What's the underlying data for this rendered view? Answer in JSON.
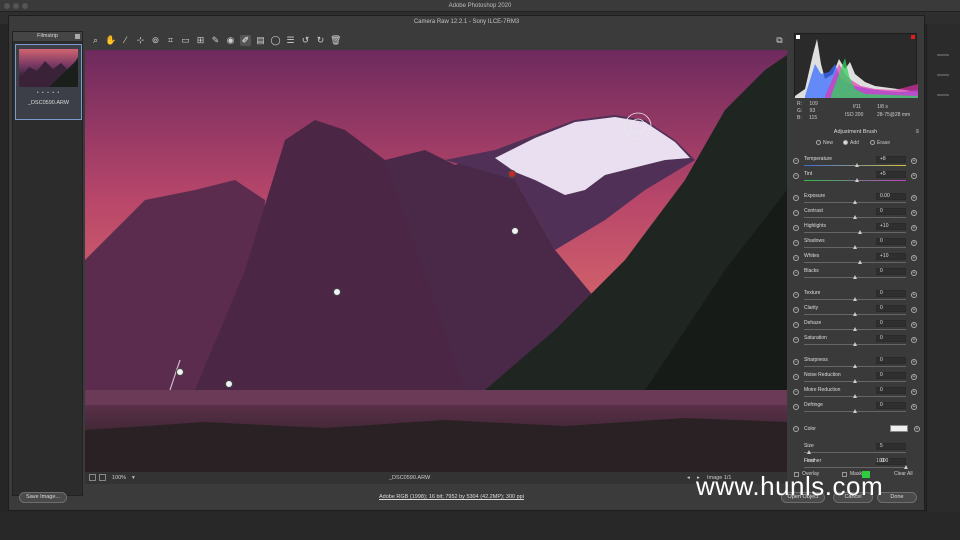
{
  "app": {
    "title": "Adobe Photoshop 2020"
  },
  "dialog": {
    "title": "Camera Raw 12.2.1  -  Sony ILCE-7RM3"
  },
  "filmstrip": {
    "label": "Filmstrip",
    "thumb_name": "_DSC0590.ARW",
    "stars": "• • • • •"
  },
  "toolbar": {
    "tools": [
      "zoom-icon",
      "hand-icon",
      "white-balance-icon",
      "color-sampler-icon",
      "target-adjust-icon",
      "crop-icon",
      "straighten-icon",
      "transform-icon",
      "spot-removal-icon",
      "red-eye-icon",
      "adjustment-brush-icon",
      "graduated-filter-icon",
      "radial-filter-icon",
      "preferences-icon",
      "rotate-left-icon",
      "rotate-right-icon",
      "trash-icon"
    ],
    "active_tool": "adjustment-brush-icon"
  },
  "readout": {
    "r_label": "R:",
    "r": "109",
    "g_label": "G:",
    "g": "93",
    "b_label": "B:",
    "b": "115",
    "aperture": "f/11",
    "shutter": "1/8 s",
    "iso": "ISO 200",
    "lens": "28-75@28 mm"
  },
  "panel": {
    "title": "Adjustment Brush",
    "modes": [
      "New",
      "Add",
      "Erase"
    ],
    "selected_mode": "Add",
    "sliders": [
      {
        "label": "Temperature",
        "value": "+8",
        "pos": 0.52
      },
      {
        "label": "Tint",
        "value": "+5",
        "pos": 0.52
      },
      {
        "label": "Exposure",
        "value": "0.00",
        "pos": 0.5
      },
      {
        "label": "Contrast",
        "value": "0",
        "pos": 0.5
      },
      {
        "label": "Highlights",
        "value": "+10",
        "pos": 0.55
      },
      {
        "label": "Shadows",
        "value": "0",
        "pos": 0.5
      },
      {
        "label": "Whites",
        "value": "+10",
        "pos": 0.55
      },
      {
        "label": "Blacks",
        "value": "0",
        "pos": 0.5
      },
      {
        "label": "Texture",
        "value": "0",
        "pos": 0.5
      },
      {
        "label": "Clarity",
        "value": "0",
        "pos": 0.5
      },
      {
        "label": "Dehaze",
        "value": "0",
        "pos": 0.5
      },
      {
        "label": "Saturation",
        "value": "0",
        "pos": 0.5
      },
      {
        "label": "Sharpness",
        "value": "0",
        "pos": 0.5
      },
      {
        "label": "Noise Reduction",
        "value": "0",
        "pos": 0.5
      },
      {
        "label": "Moire Reduction",
        "value": "0",
        "pos": 0.5
      },
      {
        "label": "Defringe",
        "value": "0",
        "pos": 0.5
      }
    ],
    "color_label": "Color",
    "size_label": "Size",
    "size_value": "5",
    "size_pos": 0.05,
    "feather_label": "Feather",
    "feather_value": "100",
    "feather_pos": 1.0,
    "flow_label": "Flow",
    "flow_value": "100",
    "overlay_label": "Overlay",
    "mask_label": "Mask",
    "clear_all_label": "Clear All",
    "mask_color": "#2ecc40"
  },
  "status": {
    "zoom": "100%",
    "filename": "_DSC0590.ARW",
    "image_counter": "Image 1/1"
  },
  "bottom": {
    "save_label": "Save Image...",
    "workflow_link": "Adobe RGB (1998); 16 bit; 7952 by 5304 (42.2MP); 300 ppi",
    "open_label": "Open Object",
    "cancel_label": "Cancel",
    "done_label": "Done"
  },
  "watermark": {
    "text": "www.hunls.com"
  }
}
